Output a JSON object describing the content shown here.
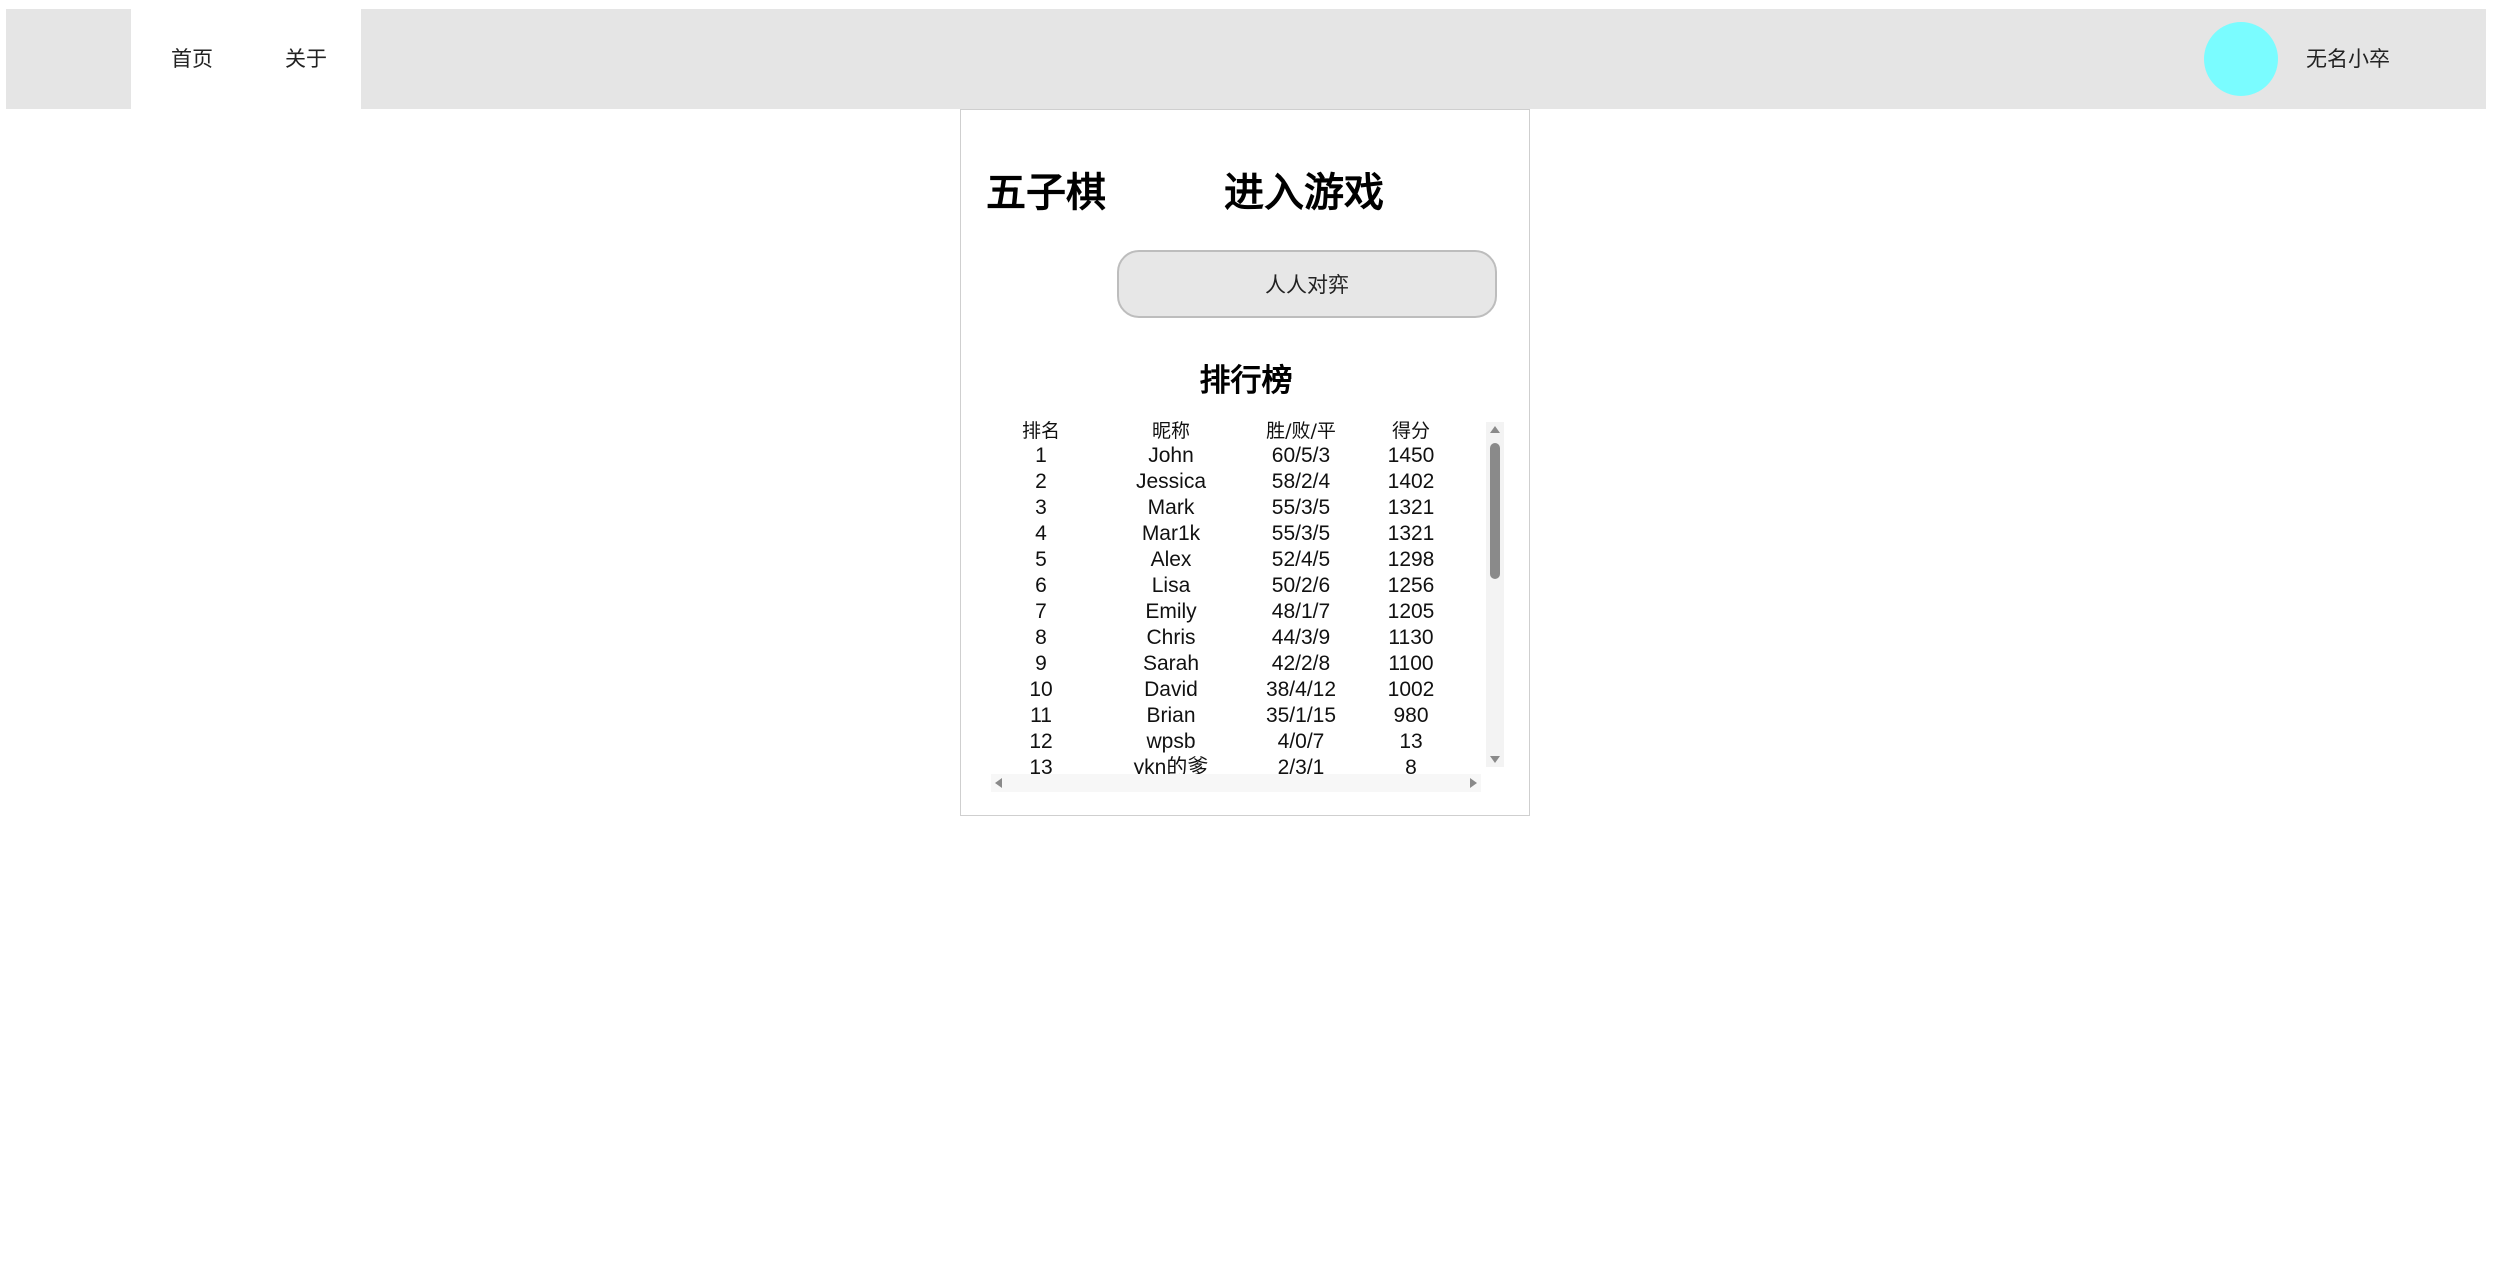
{
  "nav": {
    "home": "首页",
    "about": "关于",
    "username": "无名小卒",
    "avatar_color": "#7afcff"
  },
  "main": {
    "game_title": "五子棋",
    "enter_title": "进入游戏",
    "pvp_button": "人人对弈",
    "leaderboard_title": "排行榜"
  },
  "leaderboard": {
    "headers": [
      "排名",
      "昵称",
      "胜/败/平",
      "得分"
    ],
    "rows": [
      [
        "1",
        "John",
        "60/5/3",
        "1450"
      ],
      [
        "2",
        "Jessica",
        "58/2/4",
        "1402"
      ],
      [
        "3",
        "Mark",
        "55/3/5",
        "1321"
      ],
      [
        "4",
        "Mar1k",
        "55/3/5",
        "1321"
      ],
      [
        "5",
        "Alex",
        "52/4/5",
        "1298"
      ],
      [
        "6",
        "Lisa",
        "50/2/6",
        "1256"
      ],
      [
        "7",
        "Emily",
        "48/1/7",
        "1205"
      ],
      [
        "8",
        "Chris",
        "44/3/9",
        "1130"
      ],
      [
        "9",
        "Sarah",
        "42/2/8",
        "1100"
      ],
      [
        "10",
        "David",
        "38/4/12",
        "1002"
      ],
      [
        "11",
        "Brian",
        "35/1/15",
        "980"
      ],
      [
        "12",
        "wpsb",
        "4/0/7",
        "13"
      ],
      [
        "13",
        "ykn的爹",
        "2/3/1",
        "8"
      ]
    ]
  }
}
